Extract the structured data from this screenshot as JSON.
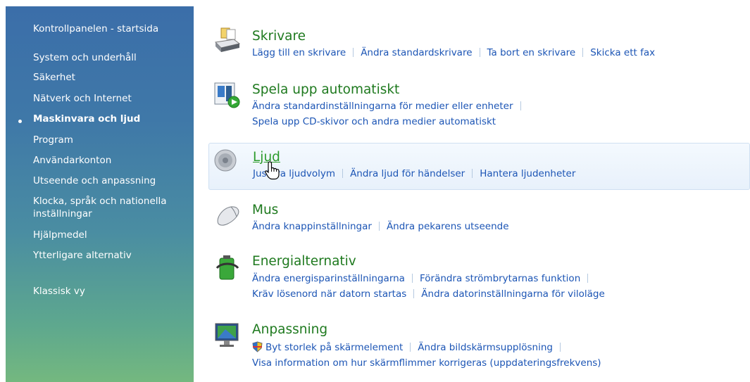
{
  "sidebar": {
    "home": "Kontrollpanelen - startsida",
    "items": [
      {
        "label": "System och underhåll"
      },
      {
        "label": "Säkerhet"
      },
      {
        "label": "Nätverk och Internet"
      },
      {
        "label": "Maskinvara och ljud",
        "active": true
      },
      {
        "label": "Program"
      },
      {
        "label": "Användarkonton"
      },
      {
        "label": "Utseende och anpassning"
      },
      {
        "label": "Klocka, språk och nationella inställningar"
      },
      {
        "label": "Hjälpmedel"
      },
      {
        "label": "Ytterligare alternativ"
      }
    ],
    "classic_view": "Klassisk vy"
  },
  "categories": {
    "printers": {
      "title": "Skrivare",
      "tasks": [
        "Lägg till en skrivare",
        "Ändra standardskrivare",
        "Ta bort en skrivare",
        "Skicka ett fax"
      ]
    },
    "autoplay": {
      "title": "Spela upp automatiskt",
      "tasks": [
        "Ändra standardinställningarna för medier eller enheter",
        "Spela upp CD-skivor och andra medier automatiskt"
      ]
    },
    "sound": {
      "title": "Ljud",
      "tasks": [
        "Justera ljudvolym",
        "Ändra ljud för händelser",
        "Hantera ljudenheter"
      ]
    },
    "mouse": {
      "title": "Mus",
      "tasks": [
        "Ändra knappinställningar",
        "Ändra pekarens utseende"
      ]
    },
    "power": {
      "title": "Energialternativ",
      "tasks": [
        "Ändra energisparinställningarna",
        "Förändra strömbrytarnas funktion",
        "Kräv lösenord när datorn startas",
        "Ändra datorinställningarna för viloläge"
      ]
    },
    "personalization": {
      "title": "Anpassning",
      "tasks": [
        "Byt storlek på skärmelement",
        "Ändra bildskärmsupplösning",
        "Visa information om hur skärmflimmer korrigeras (uppdateringsfrekvens)"
      ]
    }
  },
  "colors": {
    "title_green": "#1f7a1f",
    "link_blue": "#1c55b5",
    "sidebar_top": "#3b6ea9",
    "sidebar_bottom": "#74b87f"
  },
  "icons": [
    "printer-icon",
    "autoplay-icon",
    "speaker-icon",
    "mouse-icon",
    "power-battery-icon",
    "display-icon",
    "shield-icon",
    "hand-cursor-icon"
  ]
}
